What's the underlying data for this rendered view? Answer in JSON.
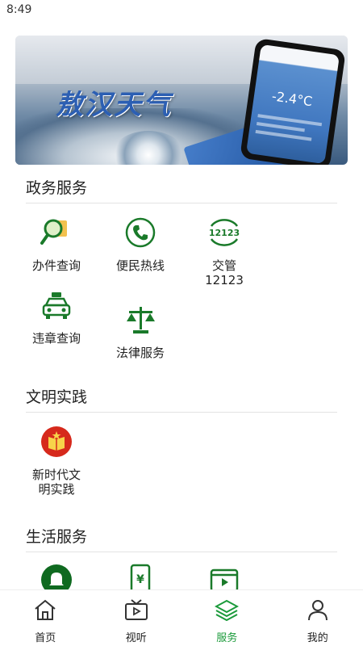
{
  "status_bar": {
    "time": "8:49"
  },
  "banner": {
    "title": "敖汉天气",
    "temp": "-2.4°C"
  },
  "sections": {
    "gov": {
      "title": "政务服务",
      "items": [
        {
          "label": "办件查询",
          "icon": "search-document-icon"
        },
        {
          "label": "便民热线",
          "icon": "phone-icon"
        },
        {
          "label": "交管12123",
          "line1": "交管",
          "line2": "12123",
          "icon": "traffic-12123-icon"
        },
        {
          "label": "违章查询",
          "icon": "car-icon"
        },
        {
          "label": "法律服务",
          "icon": "scales-icon"
        }
      ]
    },
    "civ": {
      "title": "文明实践",
      "items": [
        {
          "label": "新时代文明实践",
          "line1": "新时代文",
          "line2": "明实践",
          "icon": "civilization-book-icon"
        }
      ]
    },
    "life": {
      "title": "生活服务",
      "items": [
        {
          "icon": "bell-icon"
        },
        {
          "icon": "phone-payment-icon"
        },
        {
          "icon": "video-icon"
        },
        {
          "icon": "film-reel-icon"
        }
      ]
    }
  },
  "tabbar": {
    "items": [
      {
        "label": "首页",
        "icon": "home-icon"
      },
      {
        "label": "视听",
        "icon": "tv-icon"
      },
      {
        "label": "服务",
        "icon": "layers-icon",
        "active": true
      },
      {
        "label": "我的",
        "icon": "user-icon"
      }
    ]
  },
  "colors": {
    "brand_green": "#1a7a2a",
    "active_tab": "#1a9a3a",
    "accent_red": "#d6291c"
  }
}
